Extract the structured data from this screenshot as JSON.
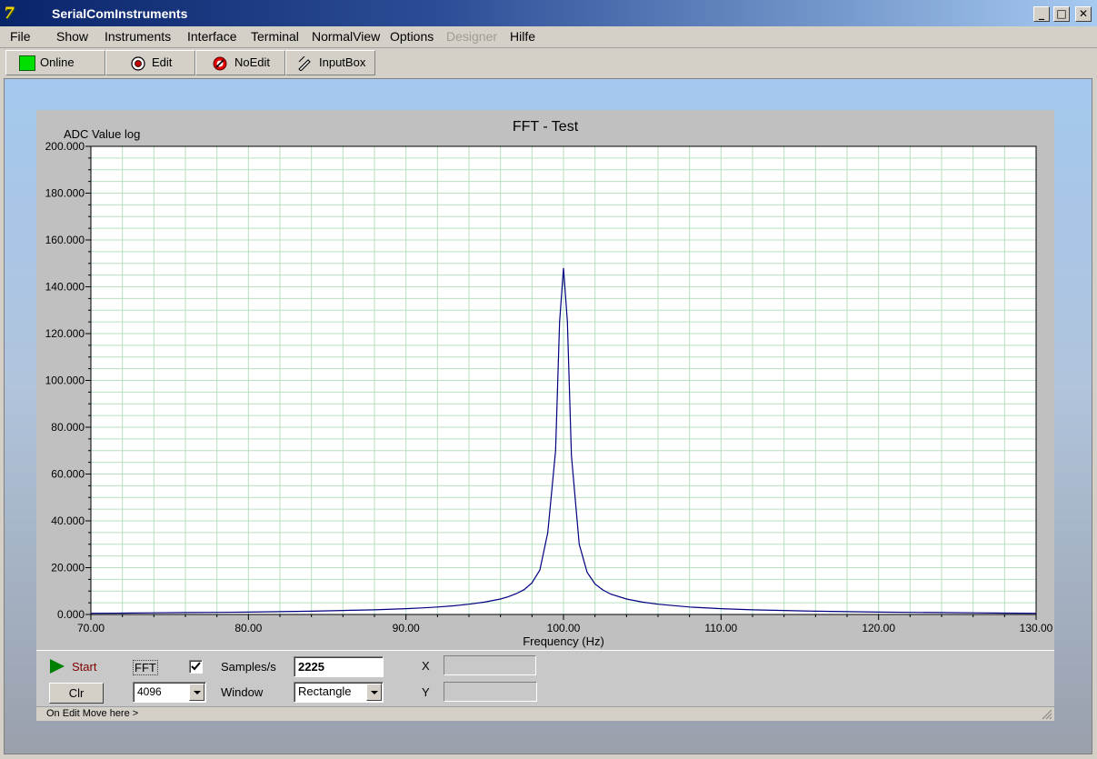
{
  "window": {
    "title": "SerialComInstruments",
    "icon": "app-logo-icon"
  },
  "window_controls": [
    "minimize-icon",
    "maximize-icon",
    "close-icon"
  ],
  "menu": {
    "items": [
      {
        "label": "File",
        "enabled": true
      },
      {
        "label": "Show",
        "enabled": true
      },
      {
        "label": "Instruments",
        "enabled": true
      },
      {
        "label": "Interface",
        "enabled": true
      },
      {
        "label": "Terminal",
        "enabled": true
      },
      {
        "label": "NormalView",
        "enabled": true
      },
      {
        "label": "Options",
        "enabled": true
      },
      {
        "label": "Designer",
        "enabled": false
      },
      {
        "label": "Hilfe",
        "enabled": true
      }
    ]
  },
  "toolbar": {
    "online_label": "Online",
    "online_color": "#00e000",
    "edit_label": "Edit",
    "noedit_label": "NoEdit",
    "inputbox_label": "InputBox"
  },
  "chart_data": {
    "type": "line",
    "title": "FFT - Test",
    "xlabel": "Frequency (Hz)",
    "ylabel": "ADC Value log",
    "xlim": [
      70,
      130
    ],
    "ylim": [
      0,
      200
    ],
    "x_ticks": [
      "70.00",
      "80.00",
      "90.00",
      "100.00",
      "110.00",
      "120.00",
      "130.00"
    ],
    "y_ticks": [
      "0.000",
      "20.000",
      "40.000",
      "60.000",
      "80.000",
      "100.000",
      "120.000",
      "140.000",
      "160.000",
      "180.000",
      "200.000"
    ],
    "grid": true,
    "line_color": "#000080",
    "grid_color": "#b8e0c0",
    "series": [
      {
        "x": [
          70,
          72,
          74,
          76,
          78,
          80,
          82,
          84,
          86,
          88,
          90,
          91,
          92,
          93,
          94,
          95,
          96,
          96.5,
          97,
          97.5,
          98,
          98.5,
          99,
          99.5,
          99.75,
          100,
          100.25,
          100.5,
          101,
          101.5,
          102,
          102.5,
          103,
          104,
          105,
          106,
          108,
          110,
          112,
          114,
          116,
          118,
          120,
          122,
          124,
          126,
          128,
          130
        ],
        "y": [
          0.5,
          0.6,
          0.7,
          0.8,
          0.9,
          1.0,
          1.2,
          1.4,
          1.7,
          2.0,
          2.5,
          2.8,
          3.2,
          3.7,
          4.4,
          5.3,
          6.6,
          7.6,
          8.9,
          10.6,
          13.5,
          19.0,
          35.0,
          70.0,
          125.0,
          148.0,
          125.0,
          68.0,
          30.0,
          18.0,
          13.0,
          10.5,
          8.7,
          6.6,
          5.3,
          4.4,
          3.2,
          2.5,
          2.0,
          1.7,
          1.4,
          1.2,
          1.0,
          0.9,
          0.8,
          0.7,
          0.6,
          0.5
        ]
      }
    ]
  },
  "controls": {
    "start_label": "Start",
    "start_color": "#008000",
    "clr_label": "Clr",
    "fft_label": "FFT",
    "fft_checked": true,
    "fft_size": "4096",
    "samples_label": "Samples/s",
    "samples_value": "2225",
    "window_label": "Window",
    "window_value": "Rectangle",
    "x_label": "X",
    "y_label": "Y",
    "x_value": "",
    "y_value": ""
  },
  "status": {
    "text": "On Edit Move here >"
  }
}
